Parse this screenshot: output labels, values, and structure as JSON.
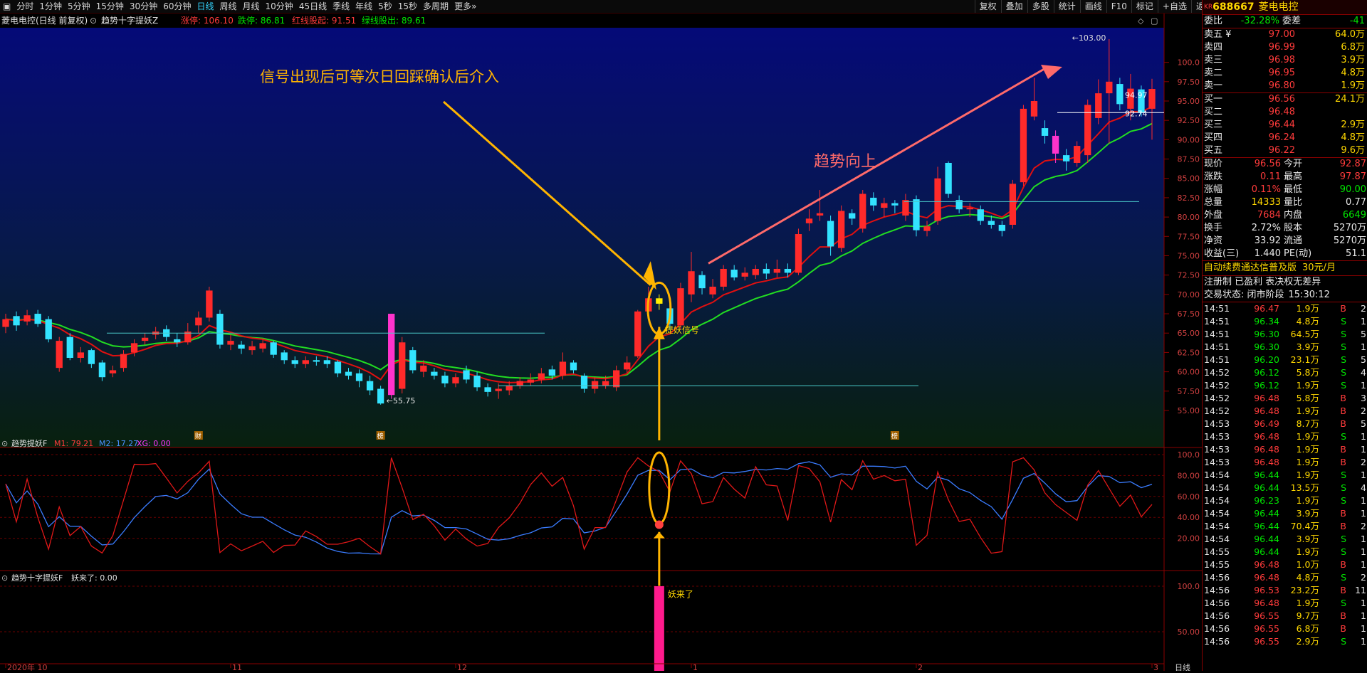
{
  "colors": {
    "up": "#ff2a2a",
    "down": "#33e3ff",
    "ma_fast": "#e01010",
    "ma_slow": "#22dd22",
    "accent": "#ffb400",
    "panel_border": "#8a0000"
  },
  "toolbar": {
    "periods": [
      "分时",
      "1分钟",
      "5分钟",
      "15分钟",
      "30分钟",
      "60分钟",
      "日线",
      "周线",
      "月线",
      "10分钟",
      "45日线",
      "季线",
      "年线",
      "5秒",
      "15秒",
      "多周期",
      "更多»"
    ],
    "active_period": "日线",
    "tools": [
      "复权",
      "叠加",
      "多股",
      "统计",
      "画线",
      "F10",
      "标记",
      "+自选",
      "返回"
    ]
  },
  "main_chart": {
    "title": "菱电电控(日线 前复权)",
    "indicator": "趋势十字提妖Z",
    "zhangting": "涨停: 106.10",
    "dieting": "跌停: 86.81",
    "hongxian": "红线股起: 91.51",
    "lvxian": "绿线股出: 89.61",
    "annotation_top": "信号出现后可等次日回踩确认后介入",
    "annotation_trend": "趋势向上",
    "signal_label": "提妖信号",
    "high_label": "103.00",
    "low_label": "55.75",
    "price_tag_1": "94.97",
    "price_tag_2": "92.74",
    "y_ticks": [
      "100.0",
      "97.50",
      "95.00",
      "92.50",
      "90.00",
      "87.50",
      "85.00",
      "82.50",
      "80.00",
      "77.50",
      "75.00",
      "72.50",
      "70.00",
      "67.50",
      "65.00",
      "62.50",
      "60.00",
      "57.50",
      "55.00"
    ],
    "markers": [
      "财",
      "榜",
      "榜"
    ]
  },
  "sub1": {
    "title": "趋势提妖F",
    "m1": "M1: 79.21",
    "m2": "M2: 17.27",
    "xg": "XG: 0.00",
    "y_ticks": [
      "100.0",
      "80.00",
      "60.00",
      "40.00",
      "20.00"
    ]
  },
  "sub2": {
    "title": "趋势十字提妖F",
    "value": "妖来了: 0.00",
    "bar_label": "妖来了",
    "y_ticks": [
      "100.0",
      "50.00"
    ]
  },
  "x_axis": {
    "labels": [
      "2020年 10",
      "11",
      "12",
      "1",
      "2",
      "3"
    ],
    "right": "日线"
  },
  "quote": {
    "code": "688667",
    "name": "菱电电控",
    "badge": "KR",
    "weibi_label": "委比",
    "weibi": "-32.28%",
    "weicha_label": "委差",
    "weicha": "-41",
    "asks": [
      {
        "label": "卖五 ¥",
        "price": "97.00",
        "vol": "64.0万"
      },
      {
        "label": "卖四",
        "price": "96.99",
        "vol": "6.8万"
      },
      {
        "label": "卖三",
        "price": "96.98",
        "vol": "3.9万"
      },
      {
        "label": "卖二",
        "price": "96.95",
        "vol": "4.8万"
      },
      {
        "label": "卖一",
        "price": "96.80",
        "vol": "1.9万"
      }
    ],
    "bids": [
      {
        "label": "买一",
        "price": "96.56",
        "vol": "24.1万"
      },
      {
        "label": "买二",
        "price": "96.48",
        "vol": ""
      },
      {
        "label": "买三",
        "price": "96.44",
        "vol": "2.9万"
      },
      {
        "label": "买四",
        "price": "96.24",
        "vol": "4.8万"
      },
      {
        "label": "买五",
        "price": "96.22",
        "vol": "9.6万"
      }
    ],
    "stats": [
      {
        "l1": "现价",
        "v1": "96.56",
        "l2": "今开",
        "v2": "92.87"
      },
      {
        "l1": "涨跌",
        "v1": "0.11",
        "l2": "最高",
        "v2": "97.87"
      },
      {
        "l1": "涨幅",
        "v1": "0.11%",
        "l2": "最低",
        "v2": "90.00"
      },
      {
        "l1": "总量",
        "v1": "14333",
        "l2": "量比",
        "v2": "0.77"
      },
      {
        "l1": "外盘",
        "v1": "7684",
        "l2": "内盘",
        "v2": "6649"
      },
      {
        "l1": "换手",
        "v1": "2.72%",
        "l2": "股本",
        "v2": "5270万"
      },
      {
        "l1": "净资",
        "v1": "33.92",
        "l2": "流通",
        "v2": "5270万"
      },
      {
        "l1": "收益(三)",
        "v1": "1.440",
        "l2": "PE(动)",
        "v2": "51.1"
      }
    ],
    "ad_text": "自动续费通达信普及版",
    "ad_price": "30元/月",
    "reg_text": "注册制 已盈利 表决权无差异",
    "trade_status": "交易状态: 闭市阶段",
    "trade_time": "15:30:12"
  },
  "ticks": [
    {
      "t": "14:51",
      "p": "96.47",
      "v": "1.9万",
      "s": "B",
      "n": "2"
    },
    {
      "t": "14:51",
      "p": "96.34",
      "v": "4.8万",
      "s": "S",
      "n": "1"
    },
    {
      "t": "14:51",
      "p": "96.30",
      "v": "64.5万",
      "s": "S",
      "n": "5"
    },
    {
      "t": "14:51",
      "p": "96.30",
      "v": "3.9万",
      "s": "S",
      "n": "1"
    },
    {
      "t": "14:51",
      "p": "96.20",
      "v": "23.1万",
      "s": "S",
      "n": "5"
    },
    {
      "t": "14:52",
      "p": "96.12",
      "v": "5.8万",
      "s": "S",
      "n": "4"
    },
    {
      "t": "14:52",
      "p": "96.12",
      "v": "1.9万",
      "s": "S",
      "n": "1"
    },
    {
      "t": "14:52",
      "p": "96.48",
      "v": "5.8万",
      "s": "B",
      "n": "3"
    },
    {
      "t": "14:52",
      "p": "96.48",
      "v": "1.9万",
      "s": "B",
      "n": "2"
    },
    {
      "t": "14:53",
      "p": "96.49",
      "v": "8.7万",
      "s": "B",
      "n": "5"
    },
    {
      "t": "14:53",
      "p": "96.48",
      "v": "1.9万",
      "s": "S",
      "n": "1"
    },
    {
      "t": "14:53",
      "p": "96.48",
      "v": "1.9万",
      "s": "B",
      "n": "1"
    },
    {
      "t": "14:53",
      "p": "96.48",
      "v": "1.9万",
      "s": "B",
      "n": "2"
    },
    {
      "t": "14:54",
      "p": "96.44",
      "v": "1.9万",
      "s": "S",
      "n": "1"
    },
    {
      "t": "14:54",
      "p": "96.44",
      "v": "13.5万",
      "s": "S",
      "n": "4"
    },
    {
      "t": "14:54",
      "p": "96.23",
      "v": "1.9万",
      "s": "S",
      "n": "1"
    },
    {
      "t": "14:54",
      "p": "96.44",
      "v": "3.9万",
      "s": "B",
      "n": "1"
    },
    {
      "t": "14:54",
      "p": "96.44",
      "v": "70.4万",
      "s": "B",
      "n": "2"
    },
    {
      "t": "14:54",
      "p": "96.44",
      "v": "3.9万",
      "s": "S",
      "n": "1"
    },
    {
      "t": "14:55",
      "p": "96.44",
      "v": "1.9万",
      "s": "S",
      "n": "1"
    },
    {
      "t": "14:55",
      "p": "96.48",
      "v": "1.0万",
      "s": "B",
      "n": "1"
    },
    {
      "t": "14:56",
      "p": "96.48",
      "v": "4.8万",
      "s": "S",
      "n": "2"
    },
    {
      "t": "14:56",
      "p": "96.53",
      "v": "23.2万",
      "s": "B",
      "n": "11"
    },
    {
      "t": "14:56",
      "p": "96.48",
      "v": "1.9万",
      "s": "S",
      "n": "1"
    },
    {
      "t": "14:56",
      "p": "96.55",
      "v": "9.7万",
      "s": "B",
      "n": "1"
    },
    {
      "t": "14:56",
      "p": "96.55",
      "v": "6.8万",
      "s": "B",
      "n": "1"
    },
    {
      "t": "14:56",
      "p": "96.55",
      "v": "2.9万",
      "s": "S",
      "n": "1"
    }
  ],
  "chart_data": {
    "type": "candlestick",
    "title": "菱电电控(日线 前复权)",
    "ylim": [
      55,
      103
    ],
    "candles": [
      {
        "o": 65.8,
        "c": 66.8,
        "h": 67.5,
        "l": 65.0
      },
      {
        "o": 67.2,
        "c": 66.0,
        "h": 67.8,
        "l": 65.3
      },
      {
        "o": 66.5,
        "c": 67.3,
        "h": 68.0,
        "l": 66.0
      },
      {
        "o": 67.5,
        "c": 66.2,
        "h": 68.0,
        "l": 65.8
      },
      {
        "o": 66.8,
        "c": 64.2,
        "h": 67.2,
        "l": 63.8
      },
      {
        "o": 60.5,
        "c": 64.0,
        "h": 64.5,
        "l": 60.0
      },
      {
        "o": 64.5,
        "c": 61.8,
        "h": 65.0,
        "l": 61.5
      },
      {
        "o": 61.8,
        "c": 62.5,
        "h": 63.2,
        "l": 61.2
      },
      {
        "o": 62.8,
        "c": 61.0,
        "h": 63.0,
        "l": 60.5
      },
      {
        "o": 61.2,
        "c": 59.3,
        "h": 61.5,
        "l": 58.8
      },
      {
        "o": 59.8,
        "c": 60.2,
        "h": 60.8,
        "l": 59.3
      },
      {
        "o": 60.5,
        "c": 62.3,
        "h": 62.8,
        "l": 60.0
      },
      {
        "o": 62.5,
        "c": 63.7,
        "h": 64.2,
        "l": 62.0
      },
      {
        "o": 64.0,
        "c": 64.4,
        "h": 65.0,
        "l": 63.5
      },
      {
        "o": 64.8,
        "c": 65.2,
        "h": 65.8,
        "l": 64.2
      },
      {
        "o": 65.5,
        "c": 64.5,
        "h": 66.0,
        "l": 64.0
      },
      {
        "o": 64.2,
        "c": 63.8,
        "h": 65.0,
        "l": 63.2
      },
      {
        "o": 63.8,
        "c": 65.2,
        "h": 66.3,
        "l": 63.5
      },
      {
        "o": 66.0,
        "c": 67.0,
        "h": 67.8,
        "l": 65.0
      },
      {
        "o": 67.0,
        "c": 70.5,
        "h": 71.0,
        "l": 66.5
      },
      {
        "o": 67.5,
        "c": 63.5,
        "h": 68.0,
        "l": 63.0
      },
      {
        "o": 63.5,
        "c": 64.0,
        "h": 64.8,
        "l": 62.8
      },
      {
        "o": 63.5,
        "c": 63.0,
        "h": 64.0,
        "l": 62.3
      },
      {
        "o": 62.8,
        "c": 63.3,
        "h": 64.0,
        "l": 62.2
      },
      {
        "o": 63.0,
        "c": 63.7,
        "h": 64.2,
        "l": 62.5
      },
      {
        "o": 63.8,
        "c": 62.2,
        "h": 64.0,
        "l": 61.8
      },
      {
        "o": 62.5,
        "c": 61.5,
        "h": 62.8,
        "l": 61.0
      },
      {
        "o": 61.5,
        "c": 61.0,
        "h": 62.0,
        "l": 60.5
      },
      {
        "o": 61.0,
        "c": 61.5,
        "h": 62.0,
        "l": 60.5
      },
      {
        "o": 61.5,
        "c": 61.3,
        "h": 62.0,
        "l": 60.8
      },
      {
        "o": 61.5,
        "c": 61.0,
        "h": 62.0,
        "l": 60.5
      },
      {
        "o": 61.3,
        "c": 59.8,
        "h": 61.5,
        "l": 59.3
      },
      {
        "o": 60.0,
        "c": 59.5,
        "h": 60.5,
        "l": 59.0
      },
      {
        "o": 59.8,
        "c": 58.8,
        "h": 60.3,
        "l": 58.0
      },
      {
        "o": 58.8,
        "c": 57.6,
        "h": 59.5,
        "l": 57.0
      },
      {
        "o": 57.8,
        "c": 55.9,
        "h": 58.2,
        "l": 55.75
      },
      {
        "o": 57.0,
        "c": 67.5,
        "h": 67.5,
        "l": 56.5
      },
      {
        "o": 57.8,
        "c": 63.8,
        "h": 64.5,
        "l": 57.2
      },
      {
        "o": 62.8,
        "c": 60.2,
        "h": 63.2,
        "l": 59.8
      },
      {
        "o": 60.0,
        "c": 60.8,
        "h": 61.5,
        "l": 59.3
      },
      {
        "o": 60.0,
        "c": 59.5,
        "h": 60.5,
        "l": 59.0
      },
      {
        "o": 59.5,
        "c": 58.5,
        "h": 60.0,
        "l": 58.0
      },
      {
        "o": 58.5,
        "c": 59.3,
        "h": 59.8,
        "l": 58.0
      },
      {
        "o": 60.2,
        "c": 59.0,
        "h": 60.8,
        "l": 58.5
      },
      {
        "o": 59.5,
        "c": 58.0,
        "h": 60.0,
        "l": 57.5
      },
      {
        "o": 58.0,
        "c": 57.4,
        "h": 58.5,
        "l": 56.8
      },
      {
        "o": 57.5,
        "c": 57.8,
        "h": 58.5,
        "l": 56.5
      },
      {
        "o": 57.6,
        "c": 58.2,
        "h": 58.8,
        "l": 57.0
      },
      {
        "o": 58.2,
        "c": 58.8,
        "h": 59.3,
        "l": 57.8
      },
      {
        "o": 58.6,
        "c": 59.0,
        "h": 59.8,
        "l": 58.2
      },
      {
        "o": 59.0,
        "c": 59.8,
        "h": 60.5,
        "l": 58.5
      },
      {
        "o": 60.3,
        "c": 59.5,
        "h": 60.8,
        "l": 59.0
      },
      {
        "o": 59.5,
        "c": 61.3,
        "h": 62.5,
        "l": 59.0
      },
      {
        "o": 61.2,
        "c": 60.2,
        "h": 61.5,
        "l": 59.8
      },
      {
        "o": 59.5,
        "c": 57.8,
        "h": 59.8,
        "l": 57.3
      },
      {
        "o": 57.8,
        "c": 58.8,
        "h": 59.3,
        "l": 57.2
      },
      {
        "o": 58.2,
        "c": 58.8,
        "h": 59.5,
        "l": 57.8
      },
      {
        "o": 58.0,
        "c": 60.2,
        "h": 60.8,
        "l": 57.5
      },
      {
        "o": 60.3,
        "c": 61.2,
        "h": 62.0,
        "l": 59.8
      },
      {
        "o": 62.0,
        "c": 67.8,
        "h": 68.0,
        "l": 61.8
      },
      {
        "o": 67.8,
        "c": 69.5,
        "h": 71.0,
        "l": 67.2
      },
      {
        "o": 69.5,
        "c": 68.8,
        "h": 70.0,
        "l": 68.0
      },
      {
        "o": 68.2,
        "c": 66.2,
        "h": 68.8,
        "l": 65.5
      },
      {
        "o": 66.0,
        "c": 70.8,
        "h": 71.5,
        "l": 65.5
      },
      {
        "o": 70.0,
        "c": 73.0,
        "h": 75.5,
        "l": 69.0
      },
      {
        "o": 72.5,
        "c": 70.8,
        "h": 73.0,
        "l": 70.0
      },
      {
        "o": 70.0,
        "c": 71.0,
        "h": 72.0,
        "l": 69.5
      },
      {
        "o": 71.0,
        "c": 73.3,
        "h": 73.8,
        "l": 70.5
      },
      {
        "o": 73.2,
        "c": 72.2,
        "h": 73.8,
        "l": 71.8
      },
      {
        "o": 72.3,
        "c": 72.8,
        "h": 73.5,
        "l": 71.8
      },
      {
        "o": 72.5,
        "c": 73.3,
        "h": 73.8,
        "l": 72.0
      },
      {
        "o": 73.3,
        "c": 72.7,
        "h": 74.0,
        "l": 72.0
      },
      {
        "o": 72.8,
        "c": 73.3,
        "h": 74.5,
        "l": 72.2
      },
      {
        "o": 73.3,
        "c": 72.8,
        "h": 74.0,
        "l": 72.2
      },
      {
        "o": 72.8,
        "c": 77.8,
        "h": 78.5,
        "l": 72.5
      },
      {
        "o": 79.2,
        "c": 79.8,
        "h": 81.0,
        "l": 78.2
      },
      {
        "o": 80.2,
        "c": 80.5,
        "h": 83.5,
        "l": 79.5
      },
      {
        "o": 79.5,
        "c": 76.2,
        "h": 80.2,
        "l": 75.0
      },
      {
        "o": 76.0,
        "c": 80.8,
        "h": 81.5,
        "l": 75.5
      },
      {
        "o": 80.5,
        "c": 79.8,
        "h": 81.0,
        "l": 79.0
      },
      {
        "o": 78.5,
        "c": 83.0,
        "h": 83.5,
        "l": 78.0
      },
      {
        "o": 82.5,
        "c": 81.5,
        "h": 83.2,
        "l": 80.8
      },
      {
        "o": 81.2,
        "c": 81.8,
        "h": 82.5,
        "l": 80.0
      },
      {
        "o": 81.8,
        "c": 81.5,
        "h": 82.2,
        "l": 80.5
      },
      {
        "o": 80.2,
        "c": 82.2,
        "h": 83.0,
        "l": 79.5
      },
      {
        "o": 82.3,
        "c": 78.3,
        "h": 82.8,
        "l": 77.5
      },
      {
        "o": 78.2,
        "c": 78.8,
        "h": 79.5,
        "l": 77.5
      },
      {
        "o": 79.5,
        "c": 85.0,
        "h": 86.5,
        "l": 79.0
      },
      {
        "o": 87.0,
        "c": 83.0,
        "h": 87.2,
        "l": 82.5
      },
      {
        "o": 82.2,
        "c": 81.0,
        "h": 82.8,
        "l": 80.5
      },
      {
        "o": 81.0,
        "c": 81.2,
        "h": 81.8,
        "l": 80.0
      },
      {
        "o": 81.0,
        "c": 79.5,
        "h": 81.5,
        "l": 79.0
      },
      {
        "o": 79.5,
        "c": 79.0,
        "h": 80.2,
        "l": 78.5
      },
      {
        "o": 79.0,
        "c": 78.2,
        "h": 79.5,
        "l": 77.5
      },
      {
        "o": 79.0,
        "c": 84.3,
        "h": 84.8,
        "l": 78.5
      },
      {
        "o": 84.5,
        "c": 94.0,
        "h": 94.5,
        "l": 84.0
      },
      {
        "o": 93.0,
        "c": 95.0,
        "h": 98.0,
        "l": 92.5
      },
      {
        "o": 91.5,
        "c": 90.5,
        "h": 92.5,
        "l": 89.5
      },
      {
        "o": 90.5,
        "c": 88.2,
        "h": 91.2,
        "l": 87.0
      },
      {
        "o": 88.0,
        "c": 87.2,
        "h": 88.8,
        "l": 86.0
      },
      {
        "o": 87.0,
        "c": 89.2,
        "h": 89.8,
        "l": 86.5
      },
      {
        "o": 88.0,
        "c": 94.5,
        "h": 95.2,
        "l": 87.0
      },
      {
        "o": 92.8,
        "c": 96.0,
        "h": 97.8,
        "l": 92.0
      },
      {
        "o": 96.0,
        "c": 97.5,
        "h": 103.0,
        "l": 89.5
      },
      {
        "o": 97.2,
        "c": 94.6,
        "h": 98.0,
        "l": 93.8
      },
      {
        "o": 94.0,
        "c": 96.6,
        "h": 98.5,
        "l": 92.5
      },
      {
        "o": 96.5,
        "c": 93.5,
        "h": 97.0,
        "l": 93.0
      },
      {
        "o": 94.0,
        "c": 96.56,
        "h": 97.87,
        "l": 90.0
      }
    ]
  }
}
